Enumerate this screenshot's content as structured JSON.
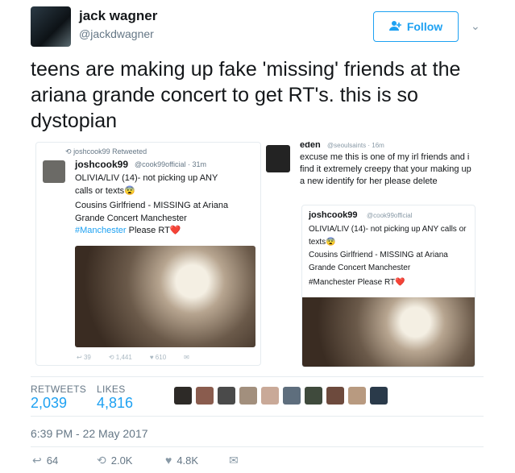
{
  "author": {
    "name": "jack wagner",
    "handle": "@jackdwagner"
  },
  "follow": {
    "label": "Follow",
    "icon": "add-user-icon"
  },
  "tweet": {
    "text": "teens are making up fake 'missing' friends at the ariana grande concert to get RT's. this is so dystopian"
  },
  "embedded_left": {
    "retweet_line": "joshcook99 Retweeted",
    "name": "joshcook99",
    "handle": "@cook99official · 31m",
    "body_1": "OLIVIA/LIV (14)- not picking up ANY calls or texts😨",
    "body_2": "Cousins Girlfriend - MISSING at Ariana Grande Concert Manchester",
    "hashtag": "#Manchester",
    "body_3": "Please RT❤️",
    "reply_count": "39",
    "rt_count": "1,441",
    "like_count": "610"
  },
  "embedded_right": {
    "name": "eden",
    "handle": "@seoulsaints · 16m",
    "body": "excuse me this is one of my irl friends and i find it extremely creepy that your making up a new identify for her please delete",
    "quoted": {
      "name": "joshcook99",
      "handle": "@cook99official",
      "body_1": "OLIVIA/LIV (14)- not picking up ANY calls or texts😨",
      "body_2": "Cousins Girlfriend - MISSING at Ariana Grande Concert Manchester",
      "body_3": "#Manchester Please RT❤️"
    }
  },
  "stats": {
    "retweets_label": "RETWEETS",
    "retweets": "2,039",
    "likes_label": "LIKES",
    "likes": "4,816"
  },
  "timestamp": "6:39 PM - 22 May 2017",
  "actions": {
    "reply": "64",
    "retweet": "2.0K",
    "like": "4.8K"
  },
  "colors": {
    "accent": "#1da1f2",
    "muted": "#657786",
    "border": "#e6ecf0"
  }
}
